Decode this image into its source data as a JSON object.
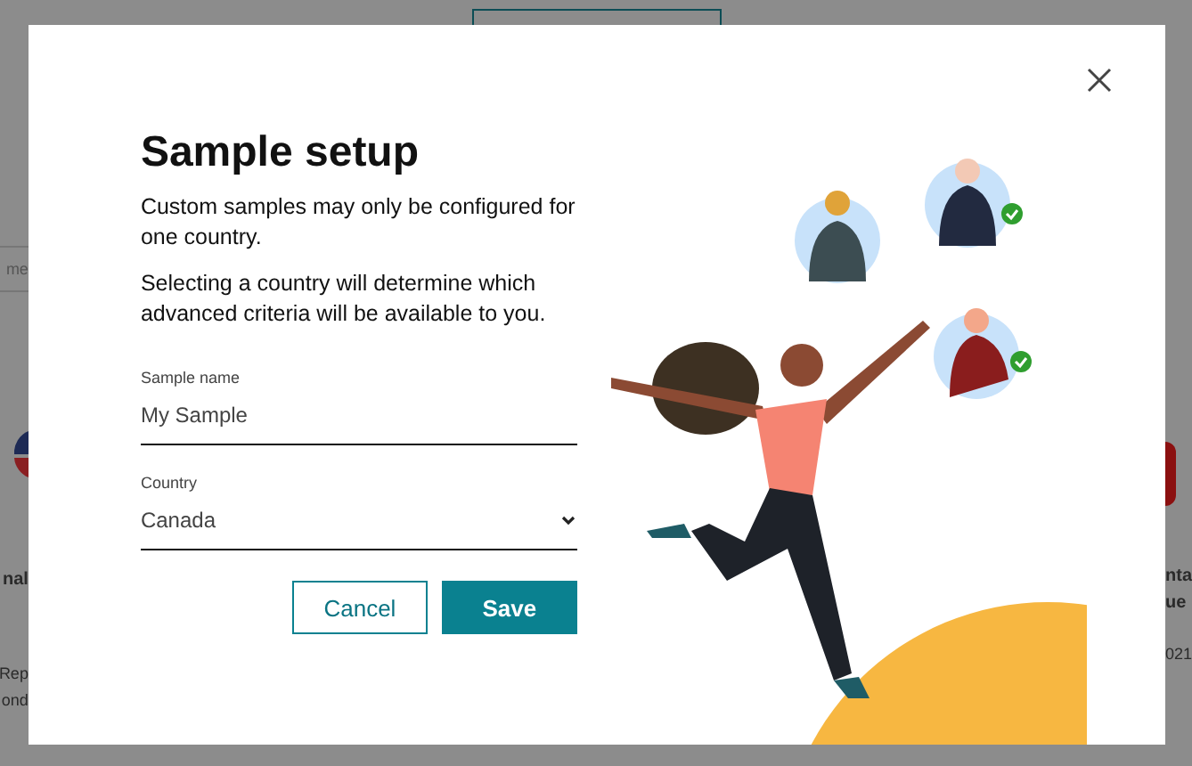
{
  "backdrop": {
    "left_fragments": [
      {
        "text": "me",
        "kind": "field"
      },
      {
        "text": "nal",
        "kind": "heading"
      },
      {
        "text": "Rep",
        "kind": "body"
      },
      {
        "text": "ond",
        "kind": "body"
      }
    ],
    "right_fragments": [
      {
        "text": "nta",
        "kind": "heading"
      },
      {
        "text": "ue",
        "kind": "heading"
      },
      {
        "text": "021",
        "kind": "body"
      }
    ]
  },
  "dialog": {
    "title": "Sample setup",
    "paragraphs": [
      "Custom samples may only be configured for one country.",
      "Selecting a country will determine which advanced criteria will be available to you."
    ],
    "fields": [
      {
        "kind": "text",
        "label": "Sample name",
        "value": "My Sample"
      },
      {
        "kind": "select",
        "label": "Country",
        "value": "Canada"
      }
    ],
    "buttons": [
      {
        "label": "Cancel",
        "kind": "secondary"
      },
      {
        "label": "Save",
        "kind": "primary"
      }
    ]
  }
}
